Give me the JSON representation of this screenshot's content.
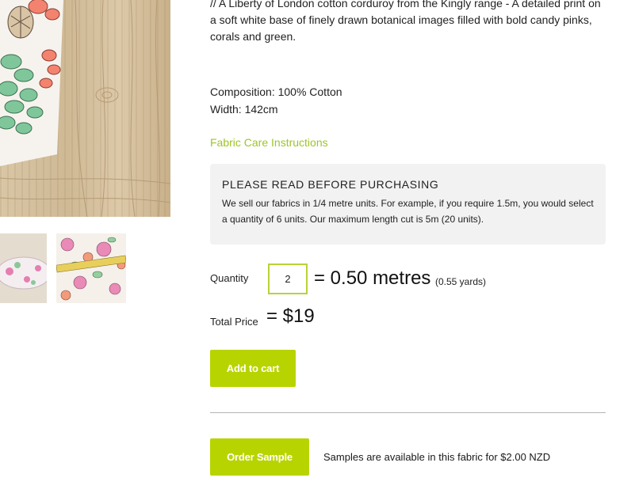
{
  "product": {
    "description": "// A Liberty of London cotton corduroy from the Kingly range - A detailed print on a soft white base of finely drawn botanical images filled with bold candy pinks, corals and green.",
    "composition": "Composition: 100% Cotton",
    "width": "Width: 142cm",
    "care_link": "Fabric Care Instructions"
  },
  "notice": {
    "title": "PLEASE READ BEFORE PURCHASING",
    "body": "We sell our fabrics in 1/4 metre units. For example, if you require 1.5m, you would select a quantity of 6 units. Our maximum length cut is 5m (20 units)."
  },
  "quantity": {
    "label": "Quantity",
    "value": "2",
    "equals": "= 0.50 metres",
    "yards": "(0.55 yards)"
  },
  "total": {
    "label": "Total Price",
    "value": "= $19"
  },
  "buttons": {
    "add_to_cart": "Add to cart",
    "order_sample": "Order Sample"
  },
  "sample": {
    "note": "Samples are available in this fabric for $2.00 NZD"
  },
  "colors": {
    "accent": "#b8d400",
    "link": "#9fc428",
    "notice_bg": "#f2f2f2"
  },
  "icons": {
    "main_image": "fabric-product-photo",
    "thumb_1": "fabric-roll-thumbnail",
    "thumb_2": "fabric-print-thumbnail"
  }
}
